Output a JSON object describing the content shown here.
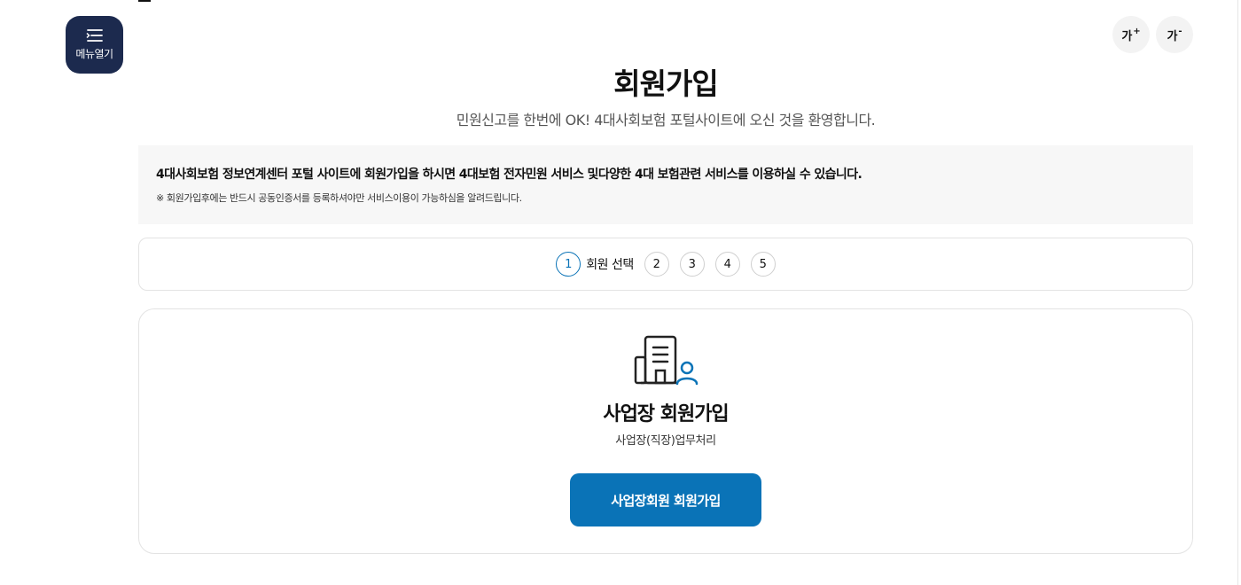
{
  "header": {
    "menu_label": "메뉴열기",
    "font_increase": {
      "label": "가",
      "sign": "+"
    },
    "font_decrease": {
      "label": "가",
      "sign": "-"
    }
  },
  "page": {
    "title": "회원가입",
    "subtitle": "민원신고를 한번에 OK! 4대사회보험 포털사이트에 오신 것을 환영합니다."
  },
  "notice": {
    "main": "4대사회보험 정보연계센터 포털 사이트에 회원가입을 하시면 4대보험 전자민원 서비스 및다양한 4대 보험관련 서비스를 이용하실 수 있습니다.",
    "sub": "※ 회원가입후에는 반드시 공동인증서를 등록하셔야만 서비스이용이 가능하심을 알려드립니다."
  },
  "steps": {
    "items": [
      "1",
      "2",
      "3",
      "4",
      "5"
    ],
    "active_label": "회원 선택",
    "active_color": "#0a73b7"
  },
  "card": {
    "icon": "building-user-icon",
    "title": "사업장 회원가입",
    "description": "사업장(직장)업무처리",
    "button_label": "사업장회원 회원가입",
    "button_color": "#0a73b7"
  }
}
